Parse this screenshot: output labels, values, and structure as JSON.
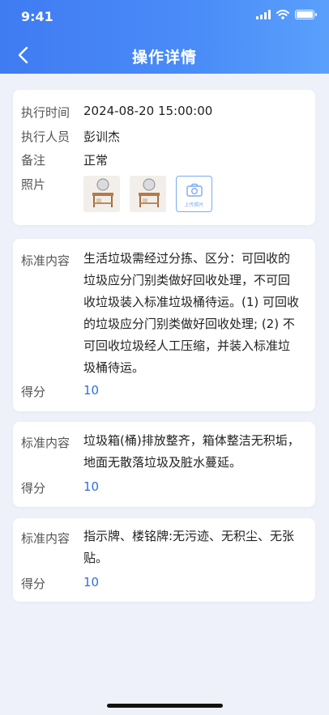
{
  "status_bar": {
    "time": "9:41"
  },
  "header": {
    "title": "操作详情"
  },
  "info_card": {
    "exec_time_label": "执行时间",
    "exec_time_value": "2024-08-20 15:00:00",
    "executor_label": "执行人员",
    "executor_value": "彭训杰",
    "remark_label": "备注",
    "remark_value": "正常",
    "photo_label": "照片",
    "upload_label": "上传照片"
  },
  "standards": [
    {
      "content_label": "标准内容",
      "content": "生活垃圾需经过分拣、区分：可回收的垃圾应分门别类做好回收处理，不可回收垃圾装入标准垃圾桶待运。(1) 可回收的垃圾应分门别类做好回收处理; (2) 不可回收垃圾经人工压缩，并装入标准垃圾桶待运。",
      "score_label": "得分",
      "score": "10"
    },
    {
      "content_label": "标准内容",
      "content": "垃圾箱(桶)排放整齐，箱体整洁无积垢，地面无散落垃圾及脏水蔓延。",
      "score_label": "得分",
      "score": "10"
    },
    {
      "content_label": "标准内容",
      "content": "指示牌、楼铭牌:无污迹、无积尘、无张贴。",
      "score_label": "得分",
      "score": "10"
    }
  ],
  "colors": {
    "header_start": "#3f7bf2",
    "header_end": "#5aa0fb",
    "score": "#2f6fe0",
    "background": "#eef1f9"
  },
  "icons": [
    "back-icon",
    "camera-icon",
    "signal-icon",
    "wifi-icon",
    "battery-icon"
  ]
}
